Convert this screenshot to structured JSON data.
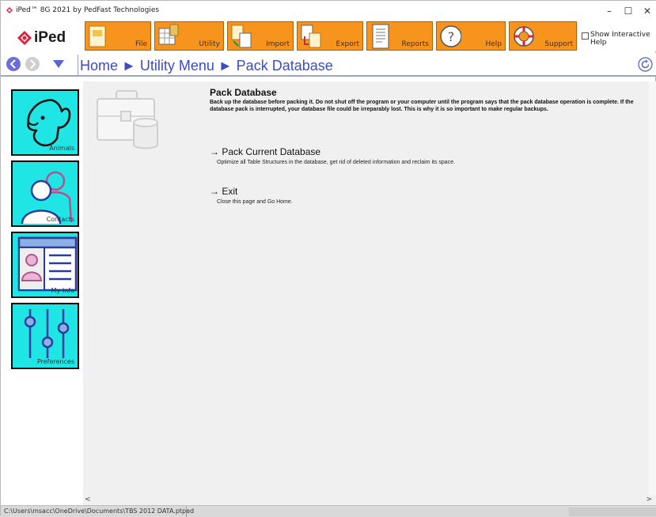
{
  "window": {
    "title": "iPed™ 8G 2021 by PedFast Technologies",
    "minimize": "–",
    "maximize": "☐",
    "close": "✕"
  },
  "logo": {
    "text": "iPed"
  },
  "ribbon": {
    "buttons": [
      {
        "label": "File",
        "icon": "file-icon"
      },
      {
        "label": "Utility",
        "icon": "utility-icon"
      },
      {
        "label": "Import",
        "icon": "import-icon"
      },
      {
        "label": "Export",
        "icon": "export-icon"
      },
      {
        "label": "Reports",
        "icon": "reports-icon"
      },
      {
        "label": "Help",
        "icon": "help-icon"
      },
      {
        "label": "Support",
        "icon": "support-icon"
      }
    ],
    "interactive_help_label": "Show Interactive Help",
    "interactive_help_checked": false,
    "accent_color": "#f7941e"
  },
  "nav": {
    "crumbs": "Home ► Utility Menu ► Pack Database"
  },
  "sidebar": {
    "tile_color": "#20e5e5",
    "items": [
      {
        "label": "Animals",
        "icon": "dog-icon"
      },
      {
        "label": "Contacts",
        "icon": "contacts-icon"
      },
      {
        "label": "My Info",
        "icon": "my-info-icon"
      },
      {
        "label": "Preferences",
        "icon": "sliders-icon"
      }
    ]
  },
  "page": {
    "title": "Pack Database",
    "description": "Back up the database before packing it. Do not shut off the program or your computer until the program says that the pack database operation is complete. If the database pack is interrupted, your database file could be irreparably lost. This is why it is so important to make regular backups.",
    "actions": [
      {
        "arrow": "→",
        "label": "Pack Current Database",
        "description": "Optimize all Table Structures in the database, get rid of deleted information and reclaim its space."
      },
      {
        "arrow": "→",
        "label": "Exit",
        "description": "Close this page and Go Home."
      }
    ]
  },
  "scroll": {
    "left": "<",
    "right": ">"
  },
  "statusbar": {
    "path": "C:\\Users\\msacc\\OneDrive\\Documents\\TBS 2012 DATA.ptped"
  }
}
